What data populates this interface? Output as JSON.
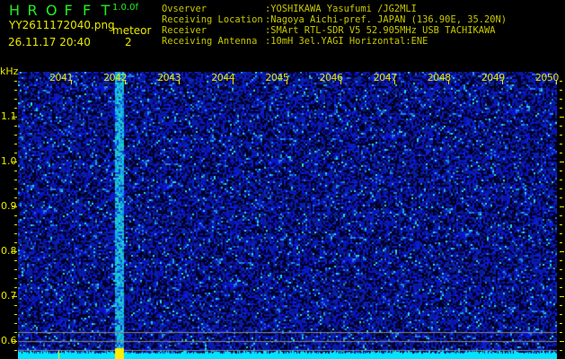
{
  "header": {
    "app_logo_letters": [
      "H",
      "R",
      "O",
      "F",
      "F",
      "T"
    ],
    "version": "1.0.0f",
    "filename": "YY2611172040.png",
    "datetime": "26.11.17 20:40",
    "meteor_label": "meteor",
    "meteor_count": "2"
  },
  "info": [
    {
      "key": "Ovserver",
      "value": ":YOSHIKAWA Yasufumi /JG2MLI"
    },
    {
      "key": "Receiving Location",
      "value": ":Nagoya Aichi-pref. JAPAN (136.90E, 35.20N)"
    },
    {
      "key": "Receiver",
      "value": ":SMArt RTL-SDR V5 52.905MHz USB TACHIKAWA"
    },
    {
      "key": "Receiving Antenna",
      "value": ":10mH 3el.YAGI Horizontal:ENE"
    }
  ],
  "axis": {
    "unit": "kHz",
    "time_labels": [
      "2041",
      "2042",
      "2043",
      "2044",
      "2045",
      "2046",
      "2047",
      "2048",
      "2049",
      "2050"
    ],
    "freq_labels": [
      "1.1",
      "1.0",
      "0.9",
      "0.8",
      "0.7",
      "0.6"
    ]
  },
  "spectrogram": {
    "meteor_minute_position": 2041.85,
    "colors": {
      "background": "#0a0a6a",
      "noise": "#2233dd",
      "bright": "#22dddd",
      "meteor": "#ffee00",
      "baseline": "#00e5ff"
    }
  }
}
